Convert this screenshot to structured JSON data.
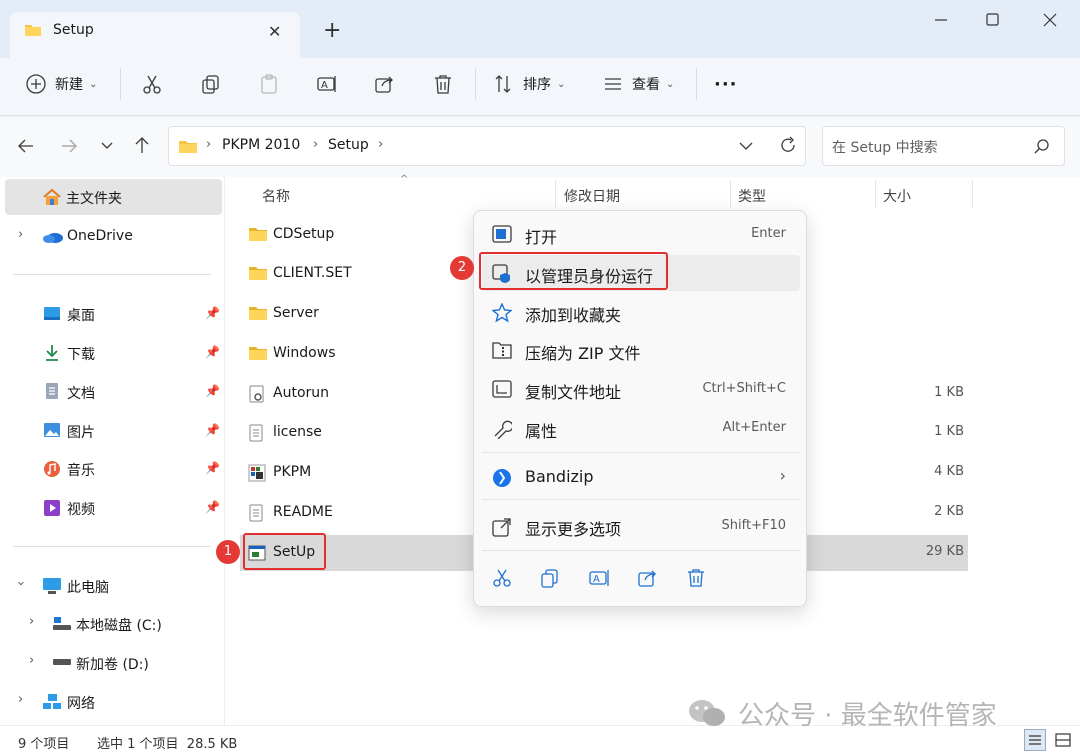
{
  "window": {
    "tab_title": "Setup",
    "close_tab": "✕",
    "new_tab": "+"
  },
  "toolbar": {
    "new_label": "新建",
    "sort_label": "排序",
    "view_label": "查看",
    "more": "···"
  },
  "address": {
    "crumbs": [
      "PKPM 2010",
      "Setup"
    ],
    "search_placeholder": "在 Setup 中搜索"
  },
  "sidebar": {
    "home": "主文件夹",
    "onedrive": "OneDrive",
    "quick": [
      {
        "label": "桌面"
      },
      {
        "label": "下载"
      },
      {
        "label": "文档"
      },
      {
        "label": "图片"
      },
      {
        "label": "音乐"
      },
      {
        "label": "视频"
      }
    ],
    "thispc": "此电脑",
    "drives": [
      {
        "label": "本地磁盘 (C:)"
      },
      {
        "label": "新加卷 (D:)"
      }
    ],
    "network": "网络"
  },
  "columns": {
    "name": "名称",
    "modified": "修改日期",
    "type": "类型",
    "size": "大小"
  },
  "files": [
    {
      "name": "CDSetup",
      "size": "",
      "kind": "folder"
    },
    {
      "name": "CLIENT.SET",
      "size": "",
      "kind": "folder"
    },
    {
      "name": "Server",
      "size": "",
      "kind": "folder"
    },
    {
      "name": "Windows",
      "size": "",
      "kind": "folder"
    },
    {
      "name": "Autorun",
      "size": "1 KB",
      "kind": "settings"
    },
    {
      "name": "license",
      "size": "1 KB",
      "kind": "text"
    },
    {
      "name": "PKPM",
      "size": "4 KB",
      "kind": "app"
    },
    {
      "name": "README",
      "size": "2 KB",
      "kind": "text"
    },
    {
      "name": "SetUp",
      "size": "29 KB",
      "kind": "exe"
    }
  ],
  "context_menu": {
    "open": {
      "label": "打开",
      "shortcut": "Enter"
    },
    "run_as_admin": {
      "label": "以管理员身份运行"
    },
    "add_favorites": {
      "label": "添加到收藏夹"
    },
    "compress_zip": {
      "label": "压缩为 ZIP 文件"
    },
    "copy_path": {
      "label": "复制文件地址",
      "shortcut": "Ctrl+Shift+C"
    },
    "properties": {
      "label": "属性",
      "shortcut": "Alt+Enter"
    },
    "bandizip": {
      "label": "Bandizip"
    },
    "more_options": {
      "label": "显示更多选项",
      "shortcut": "Shift+F10"
    }
  },
  "annotations": {
    "step1": "1",
    "step2": "2",
    "color": "#e03030"
  },
  "status": {
    "count": "9 个项目",
    "selection": "选中 1 个项目  28.5 KB"
  },
  "watermark": "公众号 · 最全软件管家",
  "colors": {
    "accent": "#0067c0",
    "folder": "#f4c542",
    "selected_row": "#d9d9d9"
  }
}
